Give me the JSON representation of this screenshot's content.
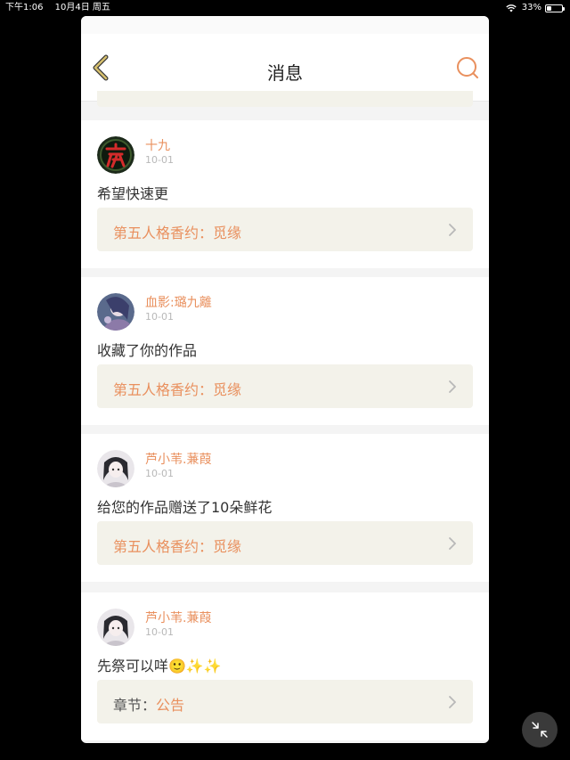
{
  "status_bar": {
    "time": "下午1:06",
    "date": "10月4日 周五",
    "battery": "33%",
    "battery_level": 0.33
  },
  "header": {
    "title": "消息",
    "back_icon": "chevron-left-icon",
    "search_icon": "search-icon"
  },
  "colors": {
    "accent": "#e9905e",
    "card_bg": "#f3f2ea",
    "back_icon": "#c9b36b"
  },
  "messages": [
    {
      "name": "十九",
      "date": "10-01",
      "text": "希望快速更",
      "avatar": "night-character-avatar",
      "work_title": "第五人格香约：觅缘",
      "work_prefix": ""
    },
    {
      "name": "血影:璐九離",
      "date": "10-01",
      "text": "收藏了你的作品",
      "avatar": "anime-girl-avatar",
      "work_title": "第五人格香约：觅缘",
      "work_prefix": ""
    },
    {
      "name": "芦小苇.蒹葭",
      "date": "10-01",
      "text": "给您的作品赠送了10朵鲜花",
      "avatar": "anime-girl-avatar",
      "work_title": "第五人格香约：觅缘",
      "work_prefix": ""
    },
    {
      "name": "芦小苇.蒹葭",
      "date": "10-01",
      "text": "先祭可以咩🙂✨✨",
      "avatar": "anime-girl-avatar",
      "work_title": "公告",
      "work_prefix": "章节："
    }
  ]
}
